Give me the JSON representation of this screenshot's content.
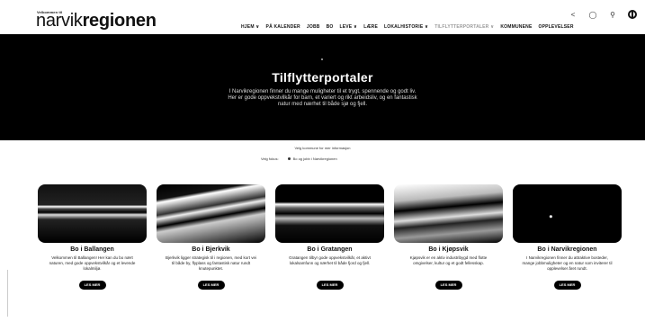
{
  "brand": {
    "tagline": "Velkommen til",
    "logo_light": "narvik",
    "logo_bold": "regionen"
  },
  "utilities": {
    "icons": [
      "share-icon",
      "user-icon",
      "search-icon",
      "globe-icon"
    ]
  },
  "nav": {
    "items": [
      {
        "label": "Hjem ∨",
        "faded": false
      },
      {
        "label": "På kalender",
        "faded": false
      },
      {
        "label": "Jobb",
        "faded": false
      },
      {
        "label": "Bo",
        "faded": false
      },
      {
        "label": "Leve ∨",
        "faded": false
      },
      {
        "label": "Lære",
        "faded": false
      },
      {
        "label": "Lokalhistorie ∨",
        "faded": false
      },
      {
        "label": "Tilflytterportaler ∨",
        "faded": true
      },
      {
        "label": "Kommunene",
        "faded": false
      },
      {
        "label": "Opplevelser",
        "faded": false
      }
    ]
  },
  "hero": {
    "title": "Tilflytterportaler",
    "text": "I Narvikregionen finner du mange muligheter til et trygt, spennende og godt liv. Her er gode oppvekstvilkår for barn, et variert og rikt arbeidsliv, og en fantastisk natur med nærhet til både sjø og fjell."
  },
  "filter": {
    "label": "Velg kommune for mer informasjon",
    "prefix": "Velg fokus:",
    "option": "Bo og jobb i Narvikregionen"
  },
  "cards": [
    {
      "title": "Bo i Ballangen",
      "text": "Velkommen til Ballangen! Her kan du bo nært naturen, med gode oppvekstvilkår og et levende lokalmiljø.",
      "button": "LES MER"
    },
    {
      "title": "Bo i Bjerkvik",
      "text": "Bjerkvik ligger strategisk til i regionen, med kort vei til både by, flyplass og fantastisk natur rundt knutepunktet.",
      "button": "LES MER"
    },
    {
      "title": "Bo i Gratangen",
      "text": "Gratangen tilbyr gode oppvekstvilkår, et aktivt lokalsamfunn og nærhet til både fjord og fjell.",
      "button": "LES MER"
    },
    {
      "title": "Bo i Kjøpsvik",
      "text": "Kjøpsvik er en aktiv industribygd med flotte omgivelser, kultur og et godt fellesskap.",
      "button": "LES MER"
    },
    {
      "title": "Bo i Narvikregionen",
      "text": "I Narvikregionen finner du attraktive bosteder, mange jobbmuligheter og en natur som inviterer til opplevelser året rundt.",
      "button": "LES MER"
    }
  ]
}
